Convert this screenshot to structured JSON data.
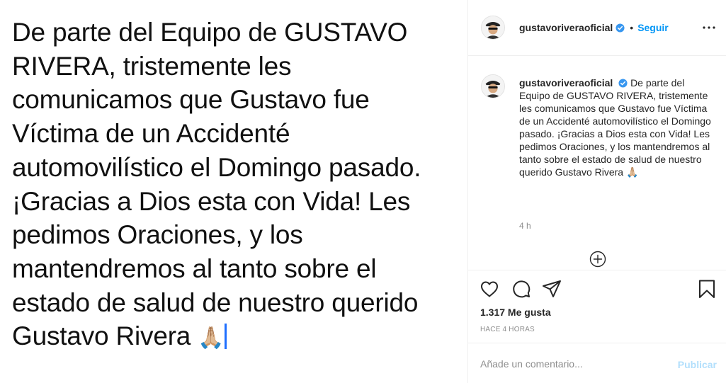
{
  "image": {
    "lines": [
      "De parte del Equipo de GUSTAVO",
      "RIVERA, tristemente les",
      "comunicamos que Gustavo fue",
      "Víctima de un Accidenté",
      "automovilístico el Domingo pasado.",
      "¡Gracias a Dios esta con Vida!  Les",
      "pedimos Oraciones, y los",
      "mantendremos al tanto sobre el",
      "estado de salud de nuestro querido",
      "Gustavo Rivera"
    ],
    "emoji": "🙏🏼"
  },
  "header": {
    "username": "gustavoriveraoficial",
    "separator": "•",
    "follow_label": "Seguir"
  },
  "caption": {
    "username": "gustavoriveraoficial",
    "text": "De parte del Equipo de GUSTAVO RIVERA, tristemente les comunicamos que Gustavo fue Víctima de un Accidenté automovilístico el Domingo pasado. ¡Gracias a Dios esta con Vida! Les pedimos Oraciones, y los mantendremos al tanto sobre el estado de salud de nuestro querido Gustavo Rivera",
    "emoji": "🙏🏼",
    "time_ago": "4 h"
  },
  "stats": {
    "likes": "1.317 Me gusta",
    "posted_at": "HACE 4 HORAS"
  },
  "comment": {
    "placeholder": "Añade un comentario...",
    "publish_label": "Publicar"
  },
  "colors": {
    "accent": "#0095f6",
    "verified": "#3897f0",
    "publish_disabled": "#b2dffc",
    "muted": "#8e8e8e"
  }
}
